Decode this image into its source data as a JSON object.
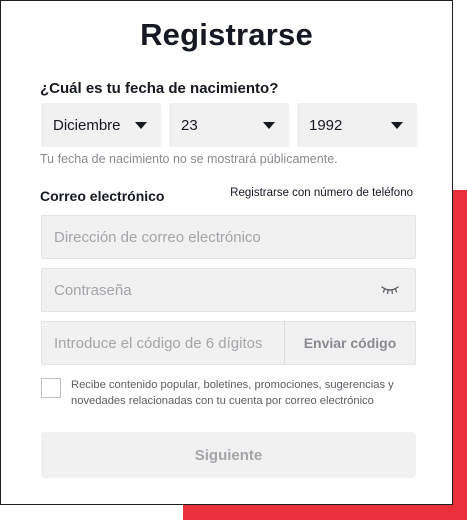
{
  "title": "Registrarse",
  "dob": {
    "label": "¿Cuál es tu fecha de nacimiento?",
    "month": "Diciembre",
    "day": "23",
    "year": "1992",
    "note": "Tu fecha de nacimiento no se mostrará públicamente."
  },
  "email": {
    "label": "Correo electrónico",
    "phone_link": "Registrarse con número de teléfono",
    "placeholder": "Dirección de correo electrónico"
  },
  "password": {
    "placeholder": "Contraseña",
    "toggle_icon": "eye-closed-icon"
  },
  "code": {
    "placeholder": "Introduce el código de 6 dígitos",
    "send_label": "Enviar código"
  },
  "consent": {
    "checked": false,
    "text": "Recibe contenido popular, boletines, promociones, sugerencias y novedades relacionadas con tu cuenta por correo electrónico"
  },
  "next_label": "Siguiente",
  "colors": {
    "accent": "#e8313b",
    "text": "#161823",
    "muted": "#8a8b91",
    "field_bg": "#f1f1f2"
  }
}
